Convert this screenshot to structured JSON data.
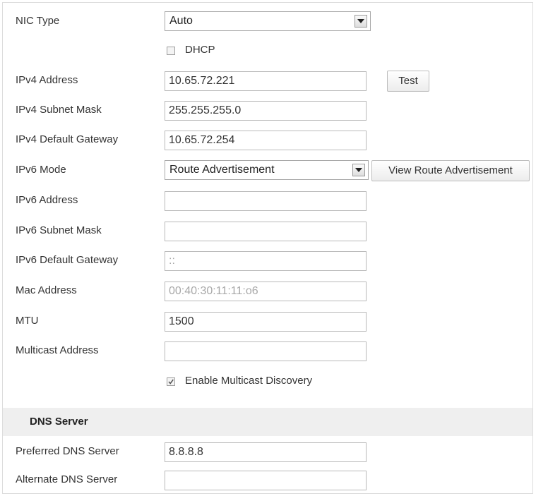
{
  "nic_type": {
    "label": "NIC Type",
    "selected": "Auto"
  },
  "dhcp": {
    "label": "DHCP",
    "checked": false
  },
  "ipv4_address": {
    "label": "IPv4 Address",
    "value": "10.65.72.221",
    "test_button": "Test"
  },
  "ipv4_subnet_mask": {
    "label": "IPv4 Subnet Mask",
    "value": "255.255.255.0"
  },
  "ipv4_default_gateway": {
    "label": "IPv4 Default Gateway",
    "value": "10.65.72.254"
  },
  "ipv6_mode": {
    "label": "IPv6 Mode",
    "selected": "Route Advertisement",
    "view_button": "View Route Advertisement"
  },
  "ipv6_address": {
    "label": "IPv6 Address",
    "value": ""
  },
  "ipv6_subnet_mask": {
    "label": "IPv6 Subnet Mask",
    "value": ""
  },
  "ipv6_default_gateway": {
    "label": "IPv6 Default Gateway",
    "value": "::"
  },
  "mac_address": {
    "label": "Mac Address",
    "value": "00:40:30:11:11:o6"
  },
  "mtu": {
    "label": "MTU",
    "value": "1500"
  },
  "multicast_address": {
    "label": "Multicast Address",
    "value": ""
  },
  "multicast_discovery": {
    "label": "Enable Multicast Discovery",
    "checked": true
  },
  "dns": {
    "section_title": "DNS Server",
    "preferred": {
      "label": "Preferred DNS Server",
      "value": "8.8.8.8"
    },
    "alternate": {
      "label": "Alternate DNS Server",
      "value": ""
    }
  },
  "colors": {
    "border": "#b9b9b9",
    "section_bg": "#efefef",
    "text": "#333333"
  },
  "icons": {
    "dropdown": "chevron-down-icon",
    "check": "checkmark-icon"
  }
}
